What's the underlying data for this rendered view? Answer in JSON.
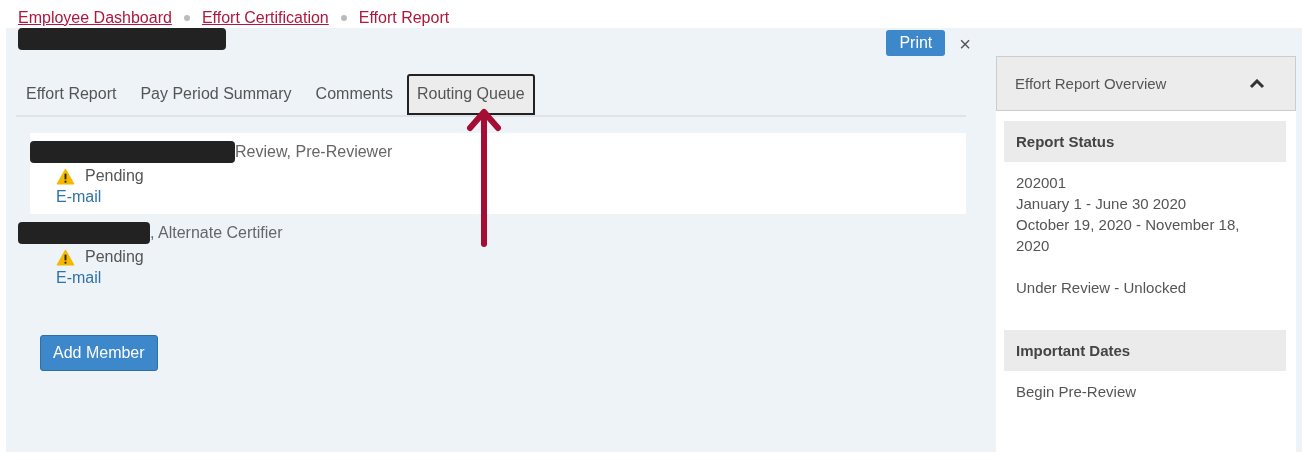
{
  "breadcrumb": [
    {
      "label": "Employee Dashboard",
      "kind": "link"
    },
    {
      "label": "Effort Certification",
      "kind": "link"
    },
    {
      "label": "Effort Report",
      "kind": "current"
    }
  ],
  "toolbar": {
    "print_button": "Print",
    "close": "×"
  },
  "tabs": [
    {
      "label": "Effort Report",
      "selected": false
    },
    {
      "label": "Pay Period Summary",
      "selected": false
    },
    {
      "label": "Comments",
      "selected": false
    },
    {
      "label": "Routing Queue",
      "selected": true
    }
  ],
  "routing_queue": [
    {
      "role": "Review, Pre-Reviewer",
      "status": "Pending",
      "email": "E-mail",
      "selected": true
    },
    {
      "role": ", Alternate Certifier",
      "status": "Pending",
      "email": "E-mail",
      "selected": false
    }
  ],
  "add_member_button": "Add Member",
  "overview": {
    "title": "Effort Report Overview",
    "expanded": true,
    "sections": [
      {
        "heading": "Report Status",
        "lines": [
          "202001",
          "January 1 - June 30 2020",
          "October 19, 2020 - November 18, 2020"
        ],
        "status": "Under Review - Unlocked"
      },
      {
        "heading": "Important Dates",
        "lines": [
          "Begin Pre-Review"
        ]
      }
    ]
  }
}
